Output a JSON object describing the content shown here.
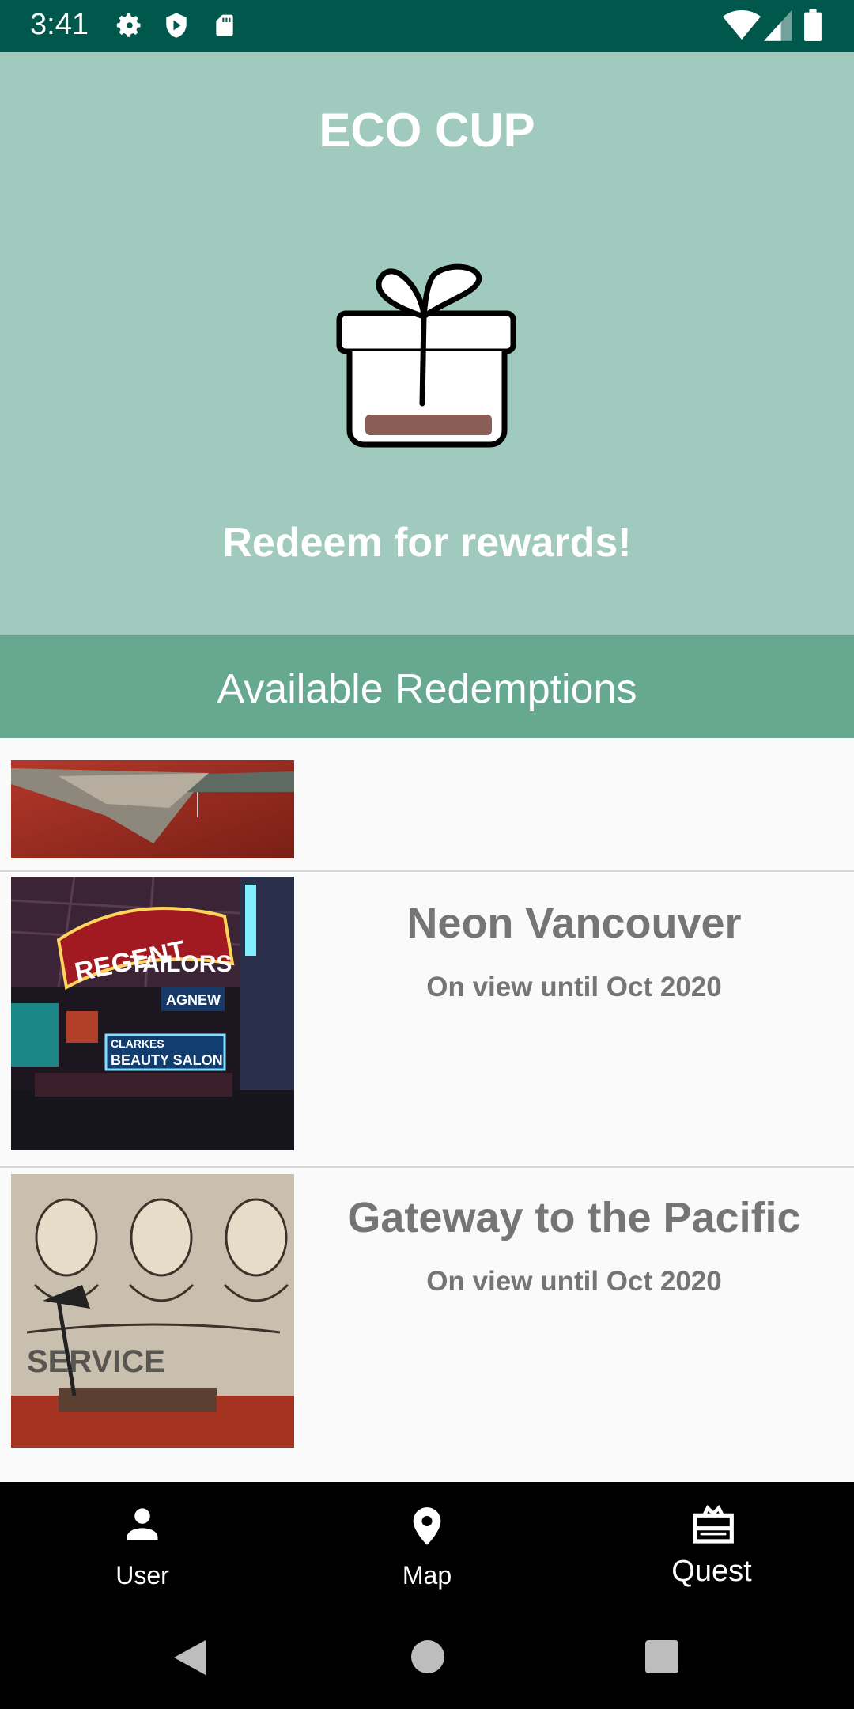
{
  "status_bar": {
    "time": "3:41"
  },
  "header": {
    "app_title": "ECO CUP",
    "caption": "Redeem for rewards!"
  },
  "section": {
    "title": "Available Redemptions"
  },
  "redemptions": [
    {
      "title": "",
      "subtitle": ""
    },
    {
      "title": "Neon Vancouver",
      "subtitle": "On view until Oct 2020"
    },
    {
      "title": "Gateway to the Pacific",
      "subtitle": "On view until Oct 2020"
    }
  ],
  "bottom_nav": {
    "items": [
      {
        "label": "User",
        "icon": "person-icon"
      },
      {
        "label": "Map",
        "icon": "map-pin-icon"
      },
      {
        "label": "Quest",
        "icon": "gift-card-icon",
        "active": true
      }
    ]
  },
  "colors": {
    "status_bar": "#00574b",
    "header_bg": "#a0cabd",
    "section_bg": "#67a891",
    "gift_bar": "#8b5e55"
  }
}
